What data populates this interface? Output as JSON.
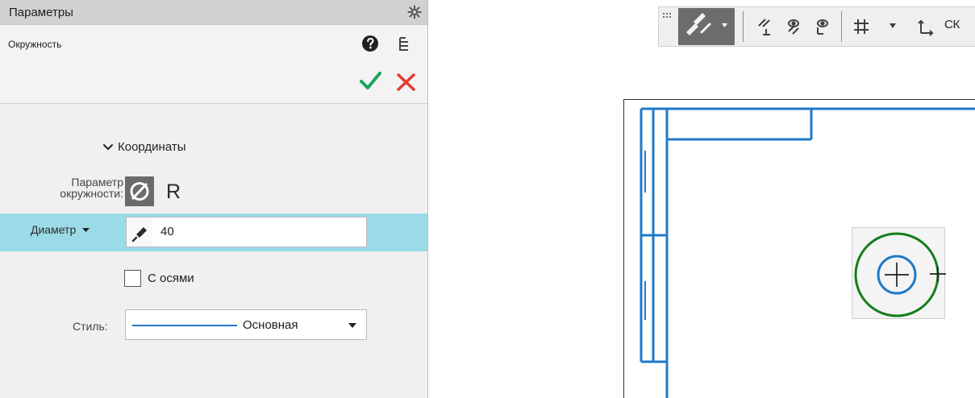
{
  "panel": {
    "title": "Параметры",
    "object_name": "Окружность",
    "section_title": "Координаты",
    "circle_param_label": "Параметр окружности:",
    "radius_symbol": "R",
    "diameter_mode": "Диаметр",
    "diameter_value": "40",
    "axes_label": "С осями",
    "style_label": "Стиль:",
    "style_value": "Основная"
  },
  "toolbar": {
    "sk_label": "СК"
  },
  "icons": {
    "gear": "gear-icon",
    "help": "help-icon",
    "tree": "tree-icon",
    "confirm": "checkmark-icon",
    "cancel": "close-icon",
    "chevron": "chevron-down-icon",
    "diameter": "diameter-icon",
    "pin": "pin-icon",
    "toolbar_snap": "snap-icon",
    "toolbar_parallel": "parallel-constraint-icon",
    "toolbar_eye1": "visibility-icon",
    "toolbar_eye2": "visibility-icon",
    "toolbar_grid": "grid-icon",
    "toolbar_axis": "coordinate-system-icon"
  },
  "colors": {
    "selection_row": "#9bdbe8",
    "accent_blue": "#1f7ac8",
    "confirm_green": "#18a55b",
    "cancel_red": "#e53935",
    "preview_green": "#157e1b"
  }
}
